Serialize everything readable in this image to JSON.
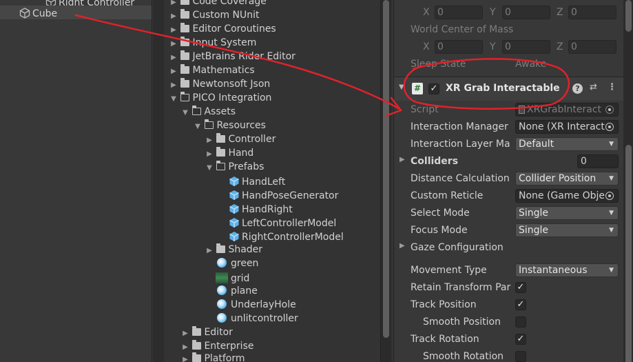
{
  "hierarchy": {
    "items": [
      {
        "label": "Right Controller"
      },
      {
        "label": "Cube"
      }
    ]
  },
  "project": {
    "items": [
      {
        "label": "Code Coverage"
      },
      {
        "label": "Custom NUnit"
      },
      {
        "label": "Editor Coroutines"
      },
      {
        "label": "Input System"
      },
      {
        "label": "JetBrains Rider Editor"
      },
      {
        "label": "Mathematics"
      },
      {
        "label": "Newtonsoft Json"
      },
      {
        "label": "PICO Integration"
      },
      {
        "label": "Assets"
      },
      {
        "label": "Resources"
      },
      {
        "label": "Controller"
      },
      {
        "label": "Hand"
      },
      {
        "label": "Prefabs"
      },
      {
        "label": "HandLeft"
      },
      {
        "label": "HandPoseGenerator"
      },
      {
        "label": "HandRight"
      },
      {
        "label": "LeftControllerModel"
      },
      {
        "label": "RightControllerModel"
      },
      {
        "label": "Shader"
      },
      {
        "label": "green"
      },
      {
        "label": "grid"
      },
      {
        "label": "plane"
      },
      {
        "label": "UnderlayHole"
      },
      {
        "label": "unlitcontroller"
      },
      {
        "label": "Editor"
      },
      {
        "label": "Enterprise"
      },
      {
        "label": "Platform"
      }
    ]
  },
  "inspector": {
    "top_xyz": {
      "x_label": "X",
      "x": "0",
      "y_label": "Y",
      "y": "0",
      "z_label": "Z",
      "z": "0"
    },
    "world_com_label": "World Center of Mass",
    "world_com": {
      "x_label": "X",
      "x": "0",
      "y_label": "Y",
      "y": "0",
      "z_label": "Z",
      "z": "0"
    },
    "sleep_state_label": "Sleep State",
    "sleep_state_value": "Awake",
    "component_title": "XR Grab Interactable",
    "component_icon": "#",
    "script_label": "Script",
    "script_value": "XRGrabInteract",
    "interaction_manager_label": "Interaction Manager",
    "interaction_manager_value": "None (XR Interact",
    "interaction_layer_label": "Interaction Layer Ma",
    "interaction_layer_value": "Default",
    "colliders_label": "Colliders",
    "colliders_value": "0",
    "distance_calc_label": "Distance Calculation",
    "distance_calc_value": "Collider Position",
    "custom_reticle_label": "Custom Reticle",
    "custom_reticle_value": "None (Game Obje",
    "select_mode_label": "Select Mode",
    "select_mode_value": "Single",
    "focus_mode_label": "Focus Mode",
    "focus_mode_value": "Single",
    "gaze_config_label": "Gaze Configuration",
    "movement_type_label": "Movement Type",
    "movement_type_value": "Instantaneous",
    "retain_transform_label": "Retain Transform Par",
    "track_position_label": "Track Position",
    "smooth_position_label": "Smooth Position",
    "track_rotation_label": "Track Rotation",
    "smooth_rotation_label": "Smooth Rotation",
    "checkmark": "✓",
    "help_icon": "?",
    "presets_icon": "⇄",
    "more_icon": "⋮"
  },
  "annotation": {
    "color": "#e0222b"
  }
}
